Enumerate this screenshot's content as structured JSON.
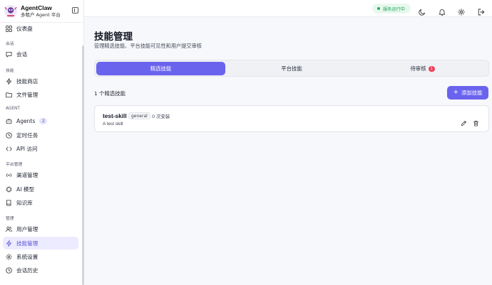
{
  "brand": {
    "name": "AgentClaw",
    "subtitle": "多租户 Agent 平台"
  },
  "sidebar": {
    "dashboard": {
      "label": "仪表盘",
      "icon": "layout-grid-icon"
    },
    "sections": [
      {
        "label": "会话"
      },
      {
        "label": "技能"
      },
      {
        "label": "AGENT"
      },
      {
        "label": "平台管理"
      },
      {
        "label": "管理"
      }
    ],
    "items": [
      {
        "label": "会话",
        "icon": "chat-icon"
      },
      {
        "label": "技能商店",
        "icon": "lightning-icon"
      },
      {
        "label": "文件管理",
        "icon": "folder-icon"
      },
      {
        "label": "Agents",
        "icon": "bot-icon",
        "badge": "2"
      },
      {
        "label": "定时任务",
        "icon": "clock-icon"
      },
      {
        "label": "API 访问",
        "icon": "code-icon"
      },
      {
        "label": "渠道管理",
        "icon": "radio-icon"
      },
      {
        "label": "AI 模型",
        "icon": "cpu-icon"
      },
      {
        "label": "知识库",
        "icon": "book-icon"
      },
      {
        "label": "用户管理",
        "icon": "users-icon"
      },
      {
        "label": "技能管理",
        "icon": "lightning-icon",
        "active": true
      },
      {
        "label": "系统设置",
        "icon": "gear-icon"
      },
      {
        "label": "会话历史",
        "icon": "history-icon"
      }
    ]
  },
  "topbar": {
    "status": "服务运行中",
    "status_color": "#23a35a",
    "icons": [
      "moon-icon",
      "bell-icon",
      "gear-icon",
      "logout-icon"
    ]
  },
  "main": {
    "title": "技能管理",
    "subtitle": "管理精选技能、平台技能可见性和用户提交审核",
    "tabs": [
      {
        "label": "精选技能",
        "active": true
      },
      {
        "label": "平台技能"
      },
      {
        "label": "待审核",
        "badge": "1"
      }
    ],
    "count_text": "1 个精选技能",
    "add_button": "添加技能",
    "skills": [
      {
        "name": "test-skill",
        "tag": "general",
        "installs": "0 次安装",
        "description": "A test skill"
      }
    ]
  },
  "colors": {
    "accent": "#6a63ee",
    "danger": "#ef3f5a",
    "active_bg": "#ecebff"
  }
}
